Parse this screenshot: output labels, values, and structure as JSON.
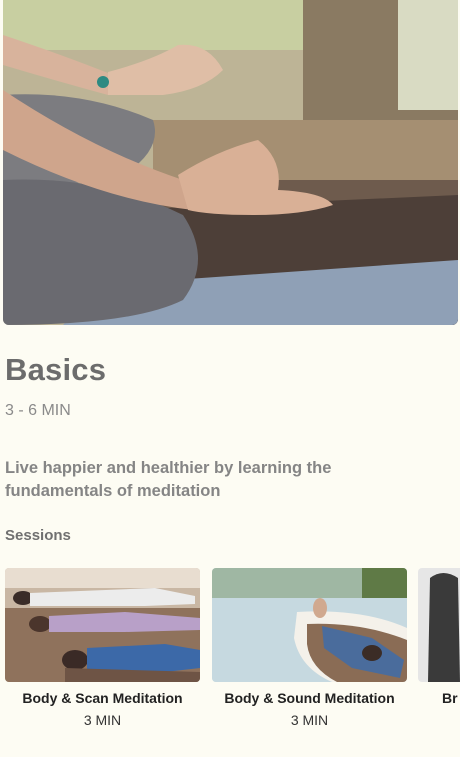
{
  "course": {
    "title": "Basics",
    "duration": "3 - 6 MIN",
    "description": "Live happier and healthier by learning the fundamentals of meditation"
  },
  "sessions": {
    "label": "Sessions",
    "items": [
      {
        "name": "Body & Scan Meditation",
        "duration": "3 MIN"
      },
      {
        "name": "Body & Sound Meditation",
        "duration": "3 MIN"
      },
      {
        "name": "Br",
        "duration": ""
      }
    ]
  },
  "colors": {
    "background": "#fdfcf3",
    "title": "#6c6c6c",
    "card_text": "#222222"
  }
}
